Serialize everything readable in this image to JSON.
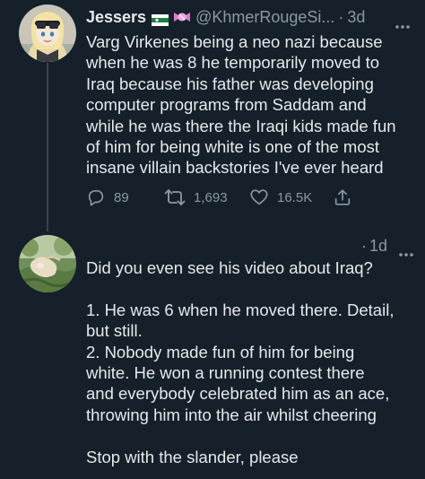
{
  "tweet1": {
    "display_name": "Jessers",
    "handle": "@KhmerRougeSi...",
    "separator": "·",
    "time": "3d",
    "text": "Varg Virkenes being a neo nazi because\nwhen he was 8 he temporarily moved to\nIraq because his father was developing\ncomputer programs from Saddam and\nwhile he was there the Iraqi kids made fun\nof him for being white is one of the most\ninsane villain backstories I've ever heard",
    "replies": "89",
    "retweets": "1,693",
    "likes": "16.5K"
  },
  "tweet2": {
    "separator": "·",
    "time": "1d",
    "text": "Did you even see his video about Iraq?\n\n1. He was 6 when he moved there. Detail,\nbut still.\n2. Nobody made fun of him for being\nwhite. He won a running contest there\nand everybody celebrated him as an ace,\nthrowing him into the air whilst cheering\n\nStop with the slander, please"
  },
  "icons": {
    "flag": "flag-icon",
    "candy": "candy-icon",
    "more": "more-icon",
    "reply": "reply-icon",
    "retweet": "retweet-icon",
    "like": "heart-icon",
    "share": "share-icon"
  },
  "colors": {
    "background": "#15202b",
    "text": "#e7e9ea",
    "muted": "#8b98a5",
    "thread_line": "#38444d"
  }
}
